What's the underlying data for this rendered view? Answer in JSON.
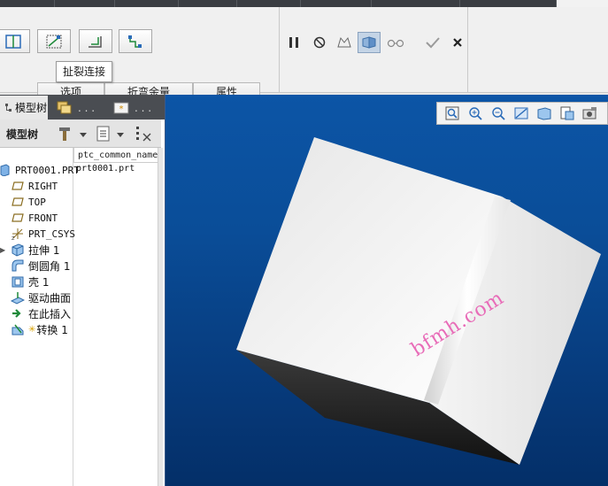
{
  "ribbon": {
    "tooltip": "扯裂连接",
    "subtabs": [
      "选项",
      "折弯余量",
      "属性"
    ]
  },
  "panel": {
    "tab_model_tree": "模型树",
    "tab_layers": ". . .",
    "tab_favorites": ". . .",
    "toolbar_title": "模型树",
    "column_header": "ptc_common_name",
    "row_value": "prt0001.prt",
    "items": [
      {
        "label": "PRT0001.PRT",
        "icon": "part-icon"
      },
      {
        "label": "RIGHT",
        "icon": "datum-plane-icon"
      },
      {
        "label": "TOP",
        "icon": "datum-plane-icon"
      },
      {
        "label": "FRONT",
        "icon": "datum-plane-icon"
      },
      {
        "label": "PRT_CSYS",
        "icon": "csys-icon"
      },
      {
        "label": "拉伸 1",
        "icon": "extrude-icon"
      },
      {
        "label": "倒圆角 1",
        "icon": "round-icon"
      },
      {
        "label": "壳 1",
        "icon": "shell-icon"
      },
      {
        "label": "驱动曲面",
        "icon": "driving-surface-icon"
      },
      {
        "label": "在此插入",
        "icon": "insert-here-icon"
      },
      {
        "label": "转换 1",
        "icon": "convert-icon"
      }
    ]
  },
  "viewport": {
    "watermark": "bfmh.com"
  },
  "colors": {
    "viewport_top": "#0c55a6",
    "viewport_bottom": "#042f68",
    "panel_tab_bg": "#4a4d52",
    "watermark": "#e86cb8"
  }
}
